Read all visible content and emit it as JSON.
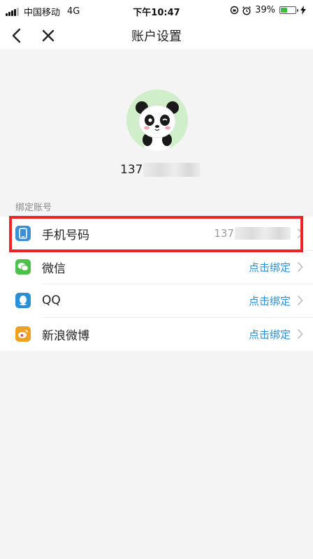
{
  "status_bar": {
    "carrier": "中国移动",
    "network": "4G",
    "time": "下午10:47",
    "battery_percent": "39%",
    "battery_level": 0.39
  },
  "nav": {
    "title": "账户设置",
    "back_icon": "chevron-left-icon",
    "close_icon": "close-icon"
  },
  "profile": {
    "avatar_icon": "panda-avatar-icon",
    "phone_prefix": "137"
  },
  "section": {
    "label": "绑定账号"
  },
  "items": [
    {
      "label": "手机号码",
      "value": "137",
      "icon": "phone-icon",
      "color": "#3a8fd6"
    },
    {
      "label": "微信",
      "value": "点击绑定",
      "icon": "wechat-icon",
      "color": "#4cc04a"
    },
    {
      "label": "QQ",
      "value": "点击绑定",
      "icon": "qq-icon",
      "color": "#2b8fd6"
    },
    {
      "label": "新浪微博",
      "value": "点击绑定",
      "icon": "weibo-icon",
      "color": "#f0a020"
    }
  ],
  "colors": {
    "accent": "#2a8ecf",
    "highlight": "#ee2424"
  }
}
